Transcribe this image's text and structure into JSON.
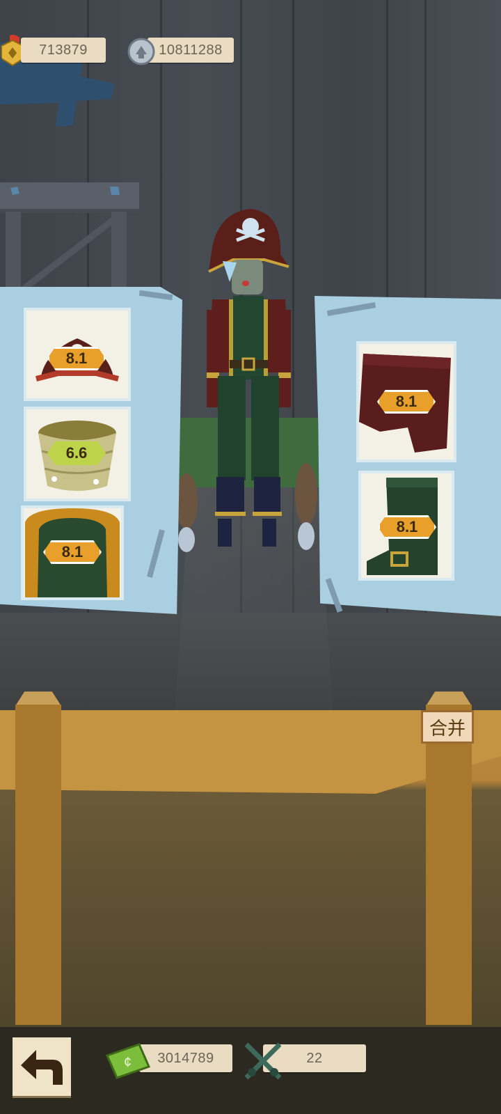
{
  "currencies": {
    "gold": {
      "value": "713879",
      "icon": "gold-medal-icon"
    },
    "silver": {
      "value": "10811288",
      "icon": "silver-coin-icon"
    },
    "cash": {
      "value": "3014789",
      "icon": "cash-icon"
    },
    "battle": {
      "value": "22",
      "icon": "crossed-swords-icon"
    }
  },
  "left_items": [
    {
      "name": "pirate hat",
      "score": "8.1",
      "badge": "orange"
    },
    {
      "name": "wicker basket",
      "score": "6.6",
      "badge": "green"
    },
    {
      "name": "pirate coat",
      "score": "8.1",
      "badge": "orange"
    }
  ],
  "right_items": [
    {
      "name": "red pants",
      "score": "8.1",
      "badge": "orange"
    },
    {
      "name": "green boots",
      "score": "8.1",
      "badge": "orange"
    }
  ],
  "buttons": {
    "merge": "合并",
    "back_icon": "back-arrow-icon"
  },
  "colors": {
    "panel": "#a9cfe0",
    "badge_orange": "#e9a02b",
    "badge_green": "#bcd34a",
    "wood": "#c59443"
  }
}
